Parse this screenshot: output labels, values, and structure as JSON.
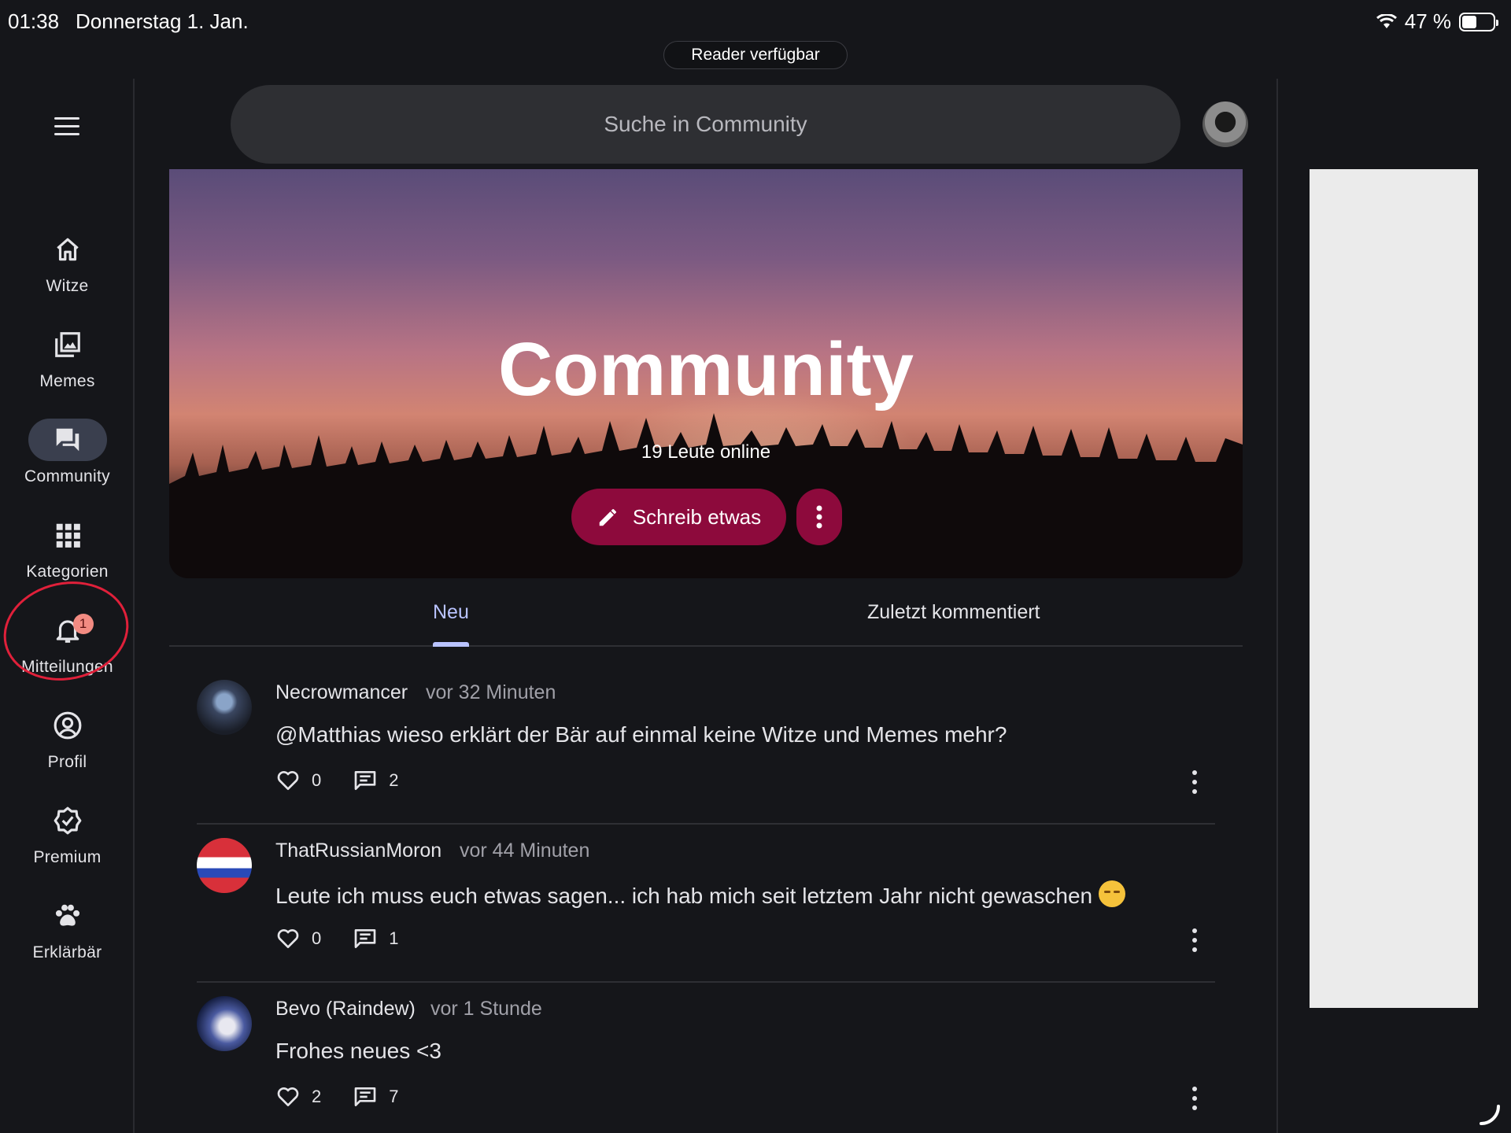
{
  "status": {
    "time": "01:38",
    "date": "Donnerstag 1. Jan.",
    "battery": "47 %",
    "battery_level": 0.47
  },
  "reader": "Reader verfügbar",
  "search": {
    "placeholder": "Suche in Community"
  },
  "nav": [
    {
      "label": "Witze",
      "icon": "home-icon"
    },
    {
      "label": "Memes",
      "icon": "image-gallery-icon"
    },
    {
      "label": "Community",
      "icon": "forum-icon",
      "active": true
    },
    {
      "label": "Kategorien",
      "icon": "grid-icon"
    },
    {
      "label": "Mitteilungen",
      "icon": "bell-icon",
      "badge": "1"
    },
    {
      "label": "Profil",
      "icon": "account-circle-icon"
    },
    {
      "label": "Premium",
      "icon": "verified-badge-icon"
    },
    {
      "label": "Erklärbär",
      "icon": "paw-icon"
    }
  ],
  "hero": {
    "title": "Community",
    "online": "19 Leute online",
    "write_label": "Schreib etwas"
  },
  "tabs": {
    "new": "Neu",
    "last_commented": "Zuletzt kommentiert"
  },
  "posts": [
    {
      "author": "Necrowmancer",
      "time": "vor 32 Minuten",
      "text": "@Matthias wieso erklärt der Bär auf einmal keine Witze und Memes mehr?",
      "likes": "0",
      "comments": "2"
    },
    {
      "author": "ThatRussianMoron",
      "time": "vor 44 Minuten",
      "text": "Leute ich muss euch etwas sagen... ich hab mich seit letztem Jahr nicht gewaschen",
      "likes": "0",
      "comments": "1"
    },
    {
      "author": "Bevo (Raindew)",
      "time": "vor 1 Stunde",
      "text": "Frohes neues <3",
      "likes": "2",
      "comments": "7"
    }
  ],
  "colors": {
    "accent": "#8d0a3c",
    "tab_active": "#b9c3ff",
    "background": "#15161a",
    "annotation": "#e0203a"
  }
}
